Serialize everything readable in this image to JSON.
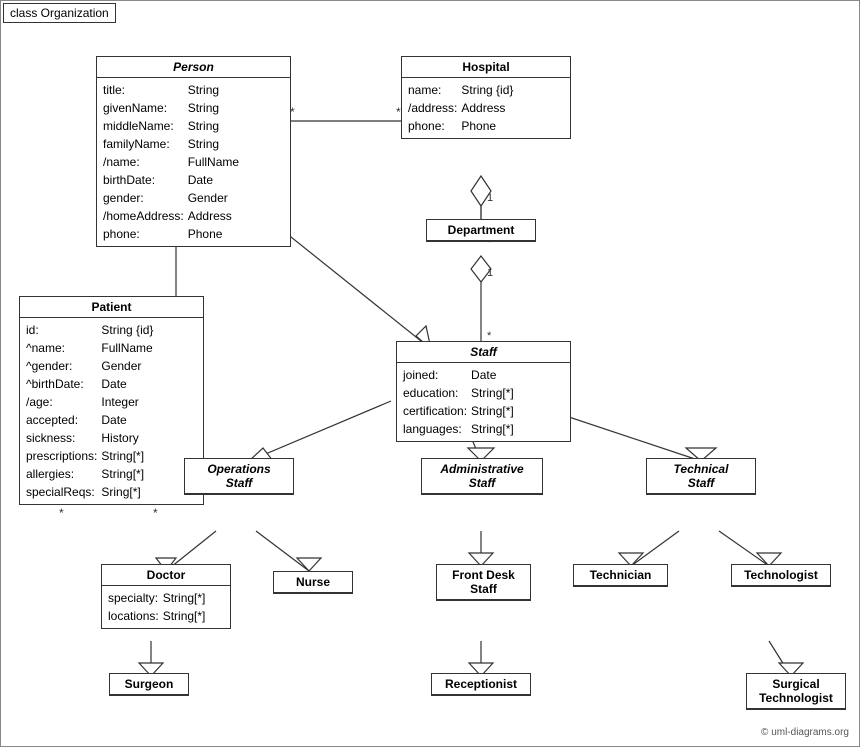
{
  "title": "class Organization",
  "copyright": "© uml-diagrams.org",
  "classes": {
    "person": {
      "name": "Person",
      "italic": true,
      "attributes": [
        [
          "title:",
          "String"
        ],
        [
          "givenName:",
          "String"
        ],
        [
          "middleName:",
          "String"
        ],
        [
          "familyName:",
          "String"
        ],
        [
          "/name:",
          "FullName"
        ],
        [
          "birthDate:",
          "Date"
        ],
        [
          "gender:",
          "Gender"
        ],
        [
          "/homeAddress:",
          "Address"
        ],
        [
          "phone:",
          "Phone"
        ]
      ]
    },
    "hospital": {
      "name": "Hospital",
      "italic": false,
      "attributes": [
        [
          "name:",
          "String {id}"
        ],
        [
          "/address:",
          "Address"
        ],
        [
          "phone:",
          "Phone"
        ]
      ]
    },
    "patient": {
      "name": "Patient",
      "italic": false,
      "attributes": [
        [
          "id:",
          "String {id}"
        ],
        [
          "^name:",
          "FullName"
        ],
        [
          "^gender:",
          "Gender"
        ],
        [
          "^birthDate:",
          "Date"
        ],
        [
          "/age:",
          "Integer"
        ],
        [
          "accepted:",
          "Date"
        ],
        [
          "sickness:",
          "History"
        ],
        [
          "prescriptions:",
          "String[*]"
        ],
        [
          "allergies:",
          "String[*]"
        ],
        [
          "specialReqs:",
          "Sring[*]"
        ]
      ]
    },
    "department": {
      "name": "Department",
      "italic": false,
      "attributes": []
    },
    "staff": {
      "name": "Staff",
      "italic": true,
      "attributes": [
        [
          "joined:",
          "Date"
        ],
        [
          "education:",
          "String[*]"
        ],
        [
          "certification:",
          "String[*]"
        ],
        [
          "languages:",
          "String[*]"
        ]
      ]
    },
    "operations_staff": {
      "name": "Operations\nStaff",
      "italic": true,
      "attributes": []
    },
    "administrative_staff": {
      "name": "Administrative\nStaff",
      "italic": true,
      "attributes": []
    },
    "technical_staff": {
      "name": "Technical\nStaff",
      "italic": true,
      "attributes": []
    },
    "doctor": {
      "name": "Doctor",
      "italic": false,
      "attributes": [
        [
          "specialty:",
          "String[*]"
        ],
        [
          "locations:",
          "String[*]"
        ]
      ]
    },
    "nurse": {
      "name": "Nurse",
      "italic": false,
      "attributes": []
    },
    "front_desk_staff": {
      "name": "Front Desk\nStaff",
      "italic": false,
      "attributes": []
    },
    "technician": {
      "name": "Technician",
      "italic": false,
      "attributes": []
    },
    "technologist": {
      "name": "Technologist",
      "italic": false,
      "attributes": []
    },
    "surgeon": {
      "name": "Surgeon",
      "italic": false,
      "attributes": []
    },
    "receptionist": {
      "name": "Receptionist",
      "italic": false,
      "attributes": []
    },
    "surgical_technologist": {
      "name": "Surgical\nTechnologist",
      "italic": false,
      "attributes": []
    }
  },
  "multiplicity_labels": {
    "person_hospital_star_left": "*",
    "person_hospital_star_right": "*",
    "hospital_dept_1": "1",
    "hospital_dept_star": "*",
    "dept_staff_1": "1",
    "dept_staff_star": "*",
    "patient_star": "*",
    "ops_patient_star": "*"
  }
}
